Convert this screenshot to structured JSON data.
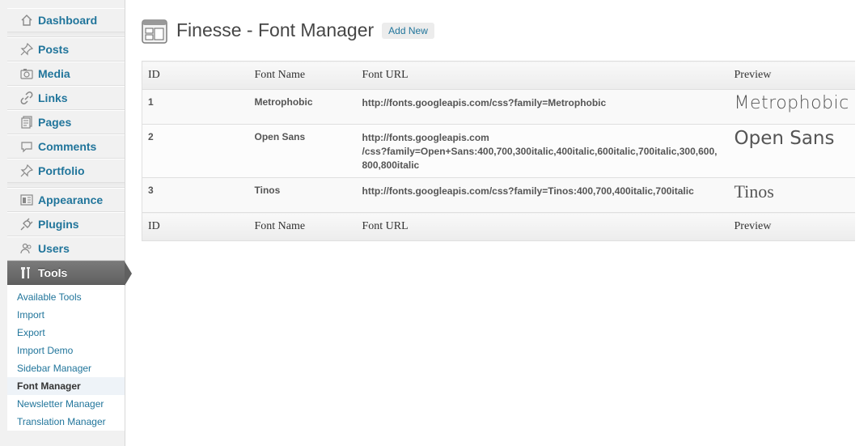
{
  "sidebar": {
    "groups": [
      [
        {
          "label": "Dashboard",
          "icon": "dashboard-icon"
        }
      ],
      [
        {
          "label": "Posts",
          "icon": "pushpin-icon"
        },
        {
          "label": "Media",
          "icon": "camera-icon"
        },
        {
          "label": "Links",
          "icon": "link-icon"
        },
        {
          "label": "Pages",
          "icon": "pages-icon"
        },
        {
          "label": "Comments",
          "icon": "comment-bubble-icon"
        },
        {
          "label": "Portfolio",
          "icon": "pushpin-icon"
        }
      ],
      [
        {
          "label": "Appearance",
          "icon": "appearance-icon"
        },
        {
          "label": "Plugins",
          "icon": "plug-icon"
        },
        {
          "label": "Users",
          "icon": "users-icon"
        },
        {
          "label": "Tools",
          "icon": "tools-icon",
          "current": true
        }
      ]
    ],
    "submenu": [
      {
        "label": "Available Tools"
      },
      {
        "label": "Import"
      },
      {
        "label": "Export"
      },
      {
        "label": "Import Demo"
      },
      {
        "label": "Sidebar Manager"
      },
      {
        "label": "Font Manager",
        "current": true
      },
      {
        "label": "Newsletter Manager"
      },
      {
        "label": "Translation Manager"
      }
    ]
  },
  "header": {
    "title": "Finesse - Font Manager",
    "add_new": "Add New",
    "icon": "page-layout-icon"
  },
  "table": {
    "columns": [
      "ID",
      "Font Name",
      "Font URL",
      "Preview"
    ],
    "rows": [
      {
        "id": "1",
        "name": "Metrophobic",
        "url": [
          "http://fonts.googleapis.com/css?family=Metrophobic"
        ],
        "preview": "Metrophobic",
        "preview_class": "pv-metro"
      },
      {
        "id": "2",
        "name": "Open Sans",
        "url": [
          "http://fonts.googleapis.com",
          "/css?family=Open+Sans:400,700,300italic,400italic,600italic,700italic,300,600,",
          "800,800italic"
        ],
        "preview": "Open Sans",
        "preview_class": "pv-open"
      },
      {
        "id": "3",
        "name": "Tinos",
        "url": [
          "http://fonts.googleapis.com/css?family=Tinos:400,700,400italic,700italic"
        ],
        "preview": "Tinos",
        "preview_class": "pv-tinos"
      }
    ]
  },
  "colors": {
    "link": "#21759b",
    "current_menu": "#6d6d6d",
    "text": "#333333"
  }
}
